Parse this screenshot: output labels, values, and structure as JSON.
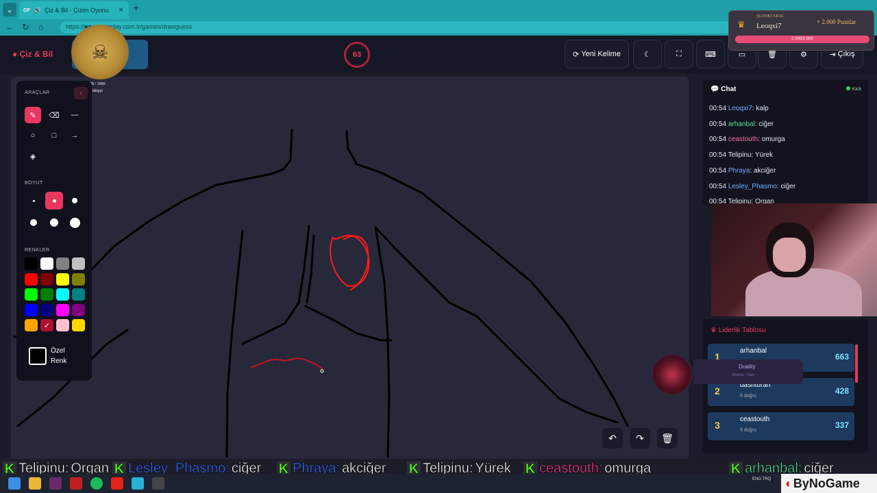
{
  "browser": {
    "tab_title": "Çiz & Bil - Çizim Oyunu",
    "tab_favicon": "CP",
    "url": "https://■■■■■■■play.com.tr/games/drawguess"
  },
  "header": {
    "logo": "Çiz & Bil",
    "timer": "63",
    "new_word": "Yeni Kelime",
    "exit": "Çıkış"
  },
  "overlay_king": {
    "label": "ŞUANKİ KRAL",
    "name": "Leoqxi7",
    "points": "+ 2.000 Puanlar",
    "progress": "2.000/2.000",
    "progress_fraction": 1.0
  },
  "follow": {
    "count": "928 / 1000",
    "label": "Takipçi"
  },
  "tools": {
    "tools_label": "ARAÇLAR",
    "size_label": "BOYUT",
    "colors_label": "RENKLER",
    "custom_color": [
      "Özel",
      "Renk"
    ],
    "palette": [
      "#000000",
      "#ffffff",
      "#808080",
      "#c0c0c0",
      "#ff0000",
      "#800000",
      "#ffff00",
      "#808000",
      "#00ff00",
      "#008000",
      "#00ffff",
      "#008080",
      "#0000ff",
      "#000080",
      "#ff00ff",
      "#800080",
      "#ffa500",
      "#a52a2a",
      "#ffc0cb",
      "#ffd700"
    ],
    "selected_color": "#a52a2a",
    "brush_color": "#e8385e"
  },
  "chat": {
    "title": "Chat",
    "platform": "Kick",
    "messages": [
      {
        "time": "00:54",
        "user": "Leoqxi7",
        "text": ": kalp",
        "color": "#6ab0ff"
      },
      {
        "time": "00:54",
        "user": "arhanbal",
        "text": ": ciğer",
        "color": "#57e39a"
      },
      {
        "time": "00:54",
        "user": "ceastouth",
        "text": ": omurga",
        "color": "#ff6b9a"
      },
      {
        "time": "00:54",
        "user": "Telipinu",
        "text": ": Yürek",
        "color": "#e6e6ee"
      },
      {
        "time": "00:54",
        "user": "Phraya",
        "text": ": akciğer",
        "color": "#7aa8ff"
      },
      {
        "time": "00:54",
        "user": "Lesley_Phasmo",
        "text": ": ciğer",
        "color": "#6ab0ff"
      },
      {
        "time": "00:54",
        "user": "Telipinu",
        "text": ": Organ",
        "color": "#e6e6ee"
      }
    ]
  },
  "leaderboard": {
    "title": "Liderlik Tablosu",
    "rows": [
      {
        "rank": "1",
        "name": "arhanbal",
        "detail": "",
        "score": "663"
      },
      {
        "rank": "2",
        "name": "dashturan",
        "detail": "6 doğru",
        "score": "428"
      },
      {
        "rank": "3",
        "name": "ceastouth",
        "detail": "5 doğru",
        "score": "337"
      }
    ]
  },
  "spotify": {
    "track": "Duality",
    "artist": "Slipknot - Topic"
  },
  "ticker": [
    {
      "user": "Telipinu",
      "text": "Organ",
      "color": "#ffffff"
    },
    {
      "user": "Lesley_Phasmo",
      "text": "ciğer",
      "color": "#3e6dff"
    },
    {
      "user": "Phraya",
      "text": "akciğer",
      "color": "#3e6dff"
    },
    {
      "user": "Telipinu",
      "text": "Yürek",
      "color": "#ffffff"
    },
    {
      "user": "ceastouth",
      "text": "omurga",
      "color": "#ff3b8e"
    },
    {
      "user": "arhanbal",
      "text": "ciğer",
      "color": "#57e39a"
    }
  ],
  "taskbar": {
    "brand": "ByNoGame",
    "lang": "ENG TRQ"
  }
}
